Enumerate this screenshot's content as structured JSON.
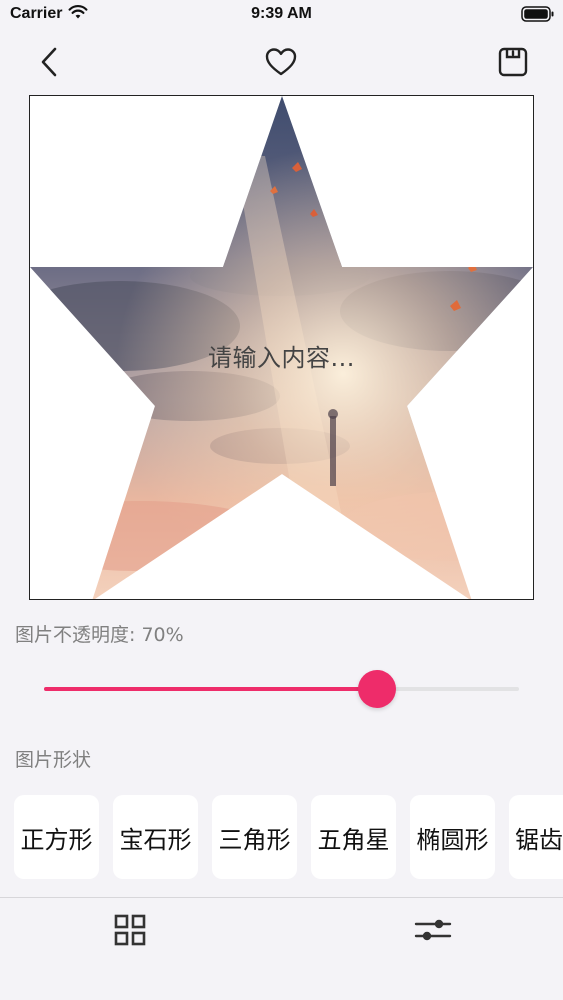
{
  "status_bar": {
    "carrier": "Carrier",
    "time": "9:39 AM"
  },
  "nav": {
    "back_icon": "chevron-left-icon",
    "like_icon": "heart-icon",
    "save_icon": "save-icon"
  },
  "canvas": {
    "overlay_text": "请输入内容...",
    "image_shape": "star",
    "image_description_colors": {
      "sky_top": "#4a5a7a",
      "sky_mid": "#8a8aa0",
      "glow": "#f6d7b8",
      "warm": "#e9a48c"
    }
  },
  "opacity": {
    "label": "图片不透明度: 70%",
    "value_fraction": 0.7,
    "accent_color": "#ee2c6a"
  },
  "shape_section": {
    "label": "图片形状",
    "options": [
      "正方形",
      "宝石形",
      "三角形",
      "五角星",
      "椭圆形",
      "锯齿"
    ]
  },
  "tab_bar": {
    "left_icon": "grid-icon",
    "right_icon": "sliders-icon"
  }
}
